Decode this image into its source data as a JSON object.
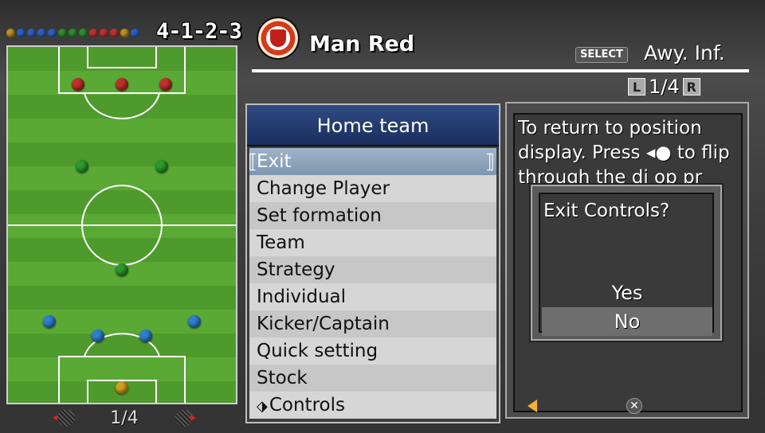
{
  "formation": {
    "label": "4-1-2-3",
    "dot_colors": [
      "#c09020",
      "#2f5fc0",
      "#2f5fc0",
      "#2f5fc0",
      "#2f5fc0",
      "#2f8f2f",
      "#2f8f2f",
      "#2f8f2f",
      "#c03030",
      "#c03030",
      "#c03030",
      "#c09020",
      "#2f5fc0"
    ]
  },
  "pitch": {
    "players": [
      {
        "role": "forward",
        "color": "#c0302a"
      },
      {
        "role": "forward",
        "color": "#c0302a"
      },
      {
        "role": "forward",
        "color": "#c0302a"
      },
      {
        "role": "midfielder",
        "color": "#2a9a2a"
      },
      {
        "role": "midfielder",
        "color": "#2a9a2a"
      },
      {
        "role": "defensive-midfielder",
        "color": "#2a9a2a"
      },
      {
        "role": "defender",
        "color": "#2f7fd0"
      },
      {
        "role": "defender",
        "color": "#2f7fd0"
      },
      {
        "role": "defender",
        "color": "#2f7fd0"
      },
      {
        "role": "defender",
        "color": "#2f7fd0"
      },
      {
        "role": "goalkeeper",
        "color": "#d0a020"
      }
    ],
    "page": "1/4"
  },
  "header": {
    "team_name": "Man Red",
    "select_badge": "SELECT",
    "away_info": "Awy. Inf.",
    "pager_left": "L",
    "pager_text": "1/4",
    "pager_right": "R"
  },
  "menu": {
    "title": "Home team",
    "items": [
      {
        "label": "Exit",
        "selected": true
      },
      {
        "label": "Change Player"
      },
      {
        "label": "Set formation"
      },
      {
        "label": "Team"
      },
      {
        "label": "Strategy"
      },
      {
        "label": "Individual"
      },
      {
        "label": "Kicker/Captain"
      },
      {
        "label": "Quick setting"
      },
      {
        "label": "Stock"
      },
      {
        "label": "Controls",
        "icon": "eraser-icon"
      }
    ]
  },
  "help": {
    "text": "To return to position display. Press ◂● to flip through the di op pr"
  },
  "dialog": {
    "title": "Exit Controls?",
    "yes_label": "Yes",
    "no_label": "No",
    "selected": "No"
  },
  "colors": {
    "menu_header": "#1b2e5e",
    "selected_item": "#8aa2ba",
    "pitch_green": "#56a332"
  }
}
